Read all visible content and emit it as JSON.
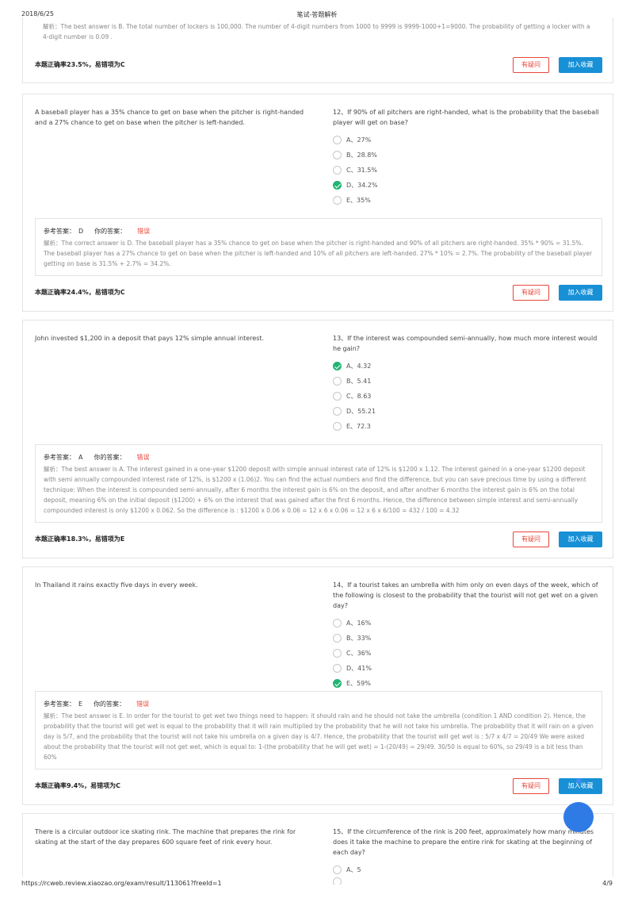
{
  "print_header": {
    "date": "2018/6/25",
    "title": "笔试-答题解析"
  },
  "print_footer": {
    "url": "https://rcweb.review.xiaozao.org/exam/result/113061?freeId=1",
    "page": "4/9"
  },
  "labels": {
    "ref_answer": "参考答案：",
    "your_answer": "你的答案：",
    "doubt_button": "有疑问",
    "favorite_button": "加入收藏"
  },
  "q11": {
    "explanation": "解析：The best answer is B. The total number of lockers is 100,000. The number of 4-digit numbers from 1000 to 9999 is 9999-1000+1=9000. The probability of getting a locker with a 4-digit number is 0.09 .",
    "rate": "本题正确率23.5%，易错项为C"
  },
  "q12": {
    "stem": "A baseball player has a 35% chance to get on base when the pitcher is right-handed and a 27% chance to get on base when the pitcher is left-handed.",
    "question": "12、If 90% of all pitchers are right-handed, what is the probability that the baseball player will get on base?",
    "options": [
      "A、27%",
      "B、28.8%",
      "C、31.5%",
      "D、34.2%",
      "E、35%"
    ],
    "selected": 3,
    "ref_answer": "D",
    "your_answer": "错误",
    "explanation": "解析：The correct answer is D.  The baseball player has a 35% chance to get on base when the pitcher is right-handed and 90% of all pitchers are right-handed.  35% * 90% = 31.5%.  The baseball player has a 27% chance to get on base when the pitcher is left-handed and 10% of all pitchers are left-handed.  27% * 10% = 2.7%.  The probability of the baseball player getting on base is 31.5% + 2.7% = 34.2%.",
    "rate": "本题正确率24.4%，易错项为C"
  },
  "q13": {
    "stem": "John invested $1,200 in a deposit that pays 12% simple annual interest.",
    "question": "13、If the interest was compounded semi-annually, how much more interest would he gain?",
    "options": [
      "A、4.32",
      "B、5.41",
      "C、8.63",
      "D、55.21",
      "E、72.3"
    ],
    "selected": 0,
    "ref_answer": "A",
    "your_answer": "错误",
    "explanation": "解析：The best answer is A. The interest gained in a one-year $1200 deposit with simple annual interest rate of 12% is $1200 x 1.12. The interest gained in a one-year $1200 deposit with semi annually compounded interest rate of 12%, is $1200 x (1.06)2. You can find the actual numbers and find the difference, but you can save precious time by using a different technique: When the interest is compounded semi-annually, after 6 months the interest gain is 6% on the deposit, and after another 6 months the interest gain is 6% on the total deposit, meaning 6% on the initial deposit ($1200) + 6% on the interest that was gained after the first 6 months. Hence, the difference between simple interest and semi-annually compounded interest is only $1200 x 0.062. So the difference is : $1200 x 0.06 x 0.06 = 12 x 6 x 0.06 = 12 x 6 x 6/100 = 432 / 100 = 4.32",
    "rate": "本题正确率18.3%，易错项为E"
  },
  "q14": {
    "stem": "In Thailand it rains exactly five days in every week.",
    "question": "14、If a tourist takes an umbrella with him only on even days of the week, which of the following is closest to the probability that the tourist will not get wet on a given day?",
    "options": [
      "A、16%",
      "B、33%",
      "C、36%",
      "D、41%",
      "E、59%"
    ],
    "selected": 4,
    "ref_answer": "E",
    "your_answer": "错误",
    "explanation": "解析：The best answer is E. In order for the tourist to get wet two things need to happen: it should rain and he should not take the umbrella (condition 1 AND condition 2). Hence, the probability that the tourist will get wet is equal to the probability that it will rain multiplied by the probability that he will not take his umbrella. The probability that it will rain on a given day is 5/7, and the probability that the tourist will not take his umbrella on a given day is 4/7. Hence, the probability that the tourist will get wet is : 5/7 x 4/7 = 20/49 We were asked about the probability that the tourist will not get wet, which is equal to: 1-(the probability that he will get wet) = 1-(20/49) = 29/49. 30/50 is equal to 60%, so 29/49 is a bit less than 60%",
    "rate": "本题正确率9.4%，易错项为C"
  },
  "q15": {
    "stem": "There is a circular outdoor ice skating rink. The machine that prepares the rink for skating at the start of the day prepares 600 square feet of rink every hour.",
    "question": "15、If the circumference of the rink is 200 feet, approximately how many minutes does it take the machine to prepare the entire rink for skating at the beginning of each day?",
    "options": [
      "A、5"
    ]
  }
}
